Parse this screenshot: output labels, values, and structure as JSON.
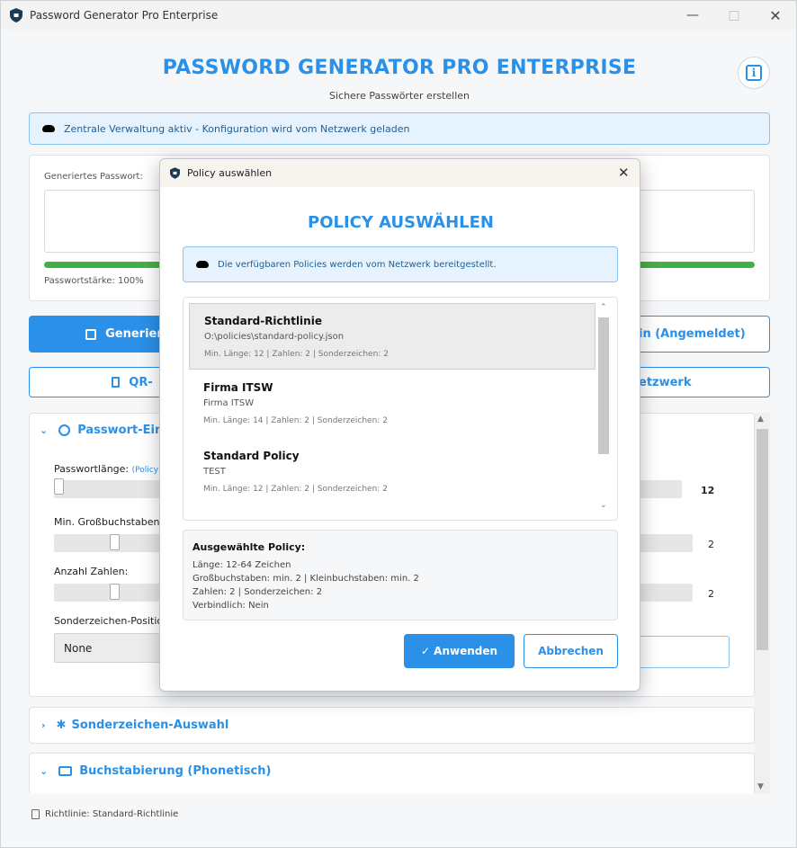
{
  "window": {
    "title": "Password Generator Pro Enterprise"
  },
  "header": {
    "title": "PASSWORD GENERATOR PRO ENTERPRISE",
    "subtitle": "Sichere Passwörter erstellen"
  },
  "banner": {
    "text": "Zentrale Verwaltung aktiv - Konfiguration wird vom Netzwerk geladen"
  },
  "password_panel": {
    "label": "Generiertes Passwort:",
    "strength_label": "Passwortstärke:",
    "strength_value": "100%",
    "strength_fraction": 1.0
  },
  "buttons": {
    "generate": "Generieren",
    "login_suffix": "in (Angemeldet)",
    "qr_prefix": "QR-",
    "network_suffix": "etzwerk"
  },
  "settings": {
    "section_title": "Passwort-Einst",
    "length_label": "Passwortlänge:",
    "length_hint": "(Policy a",
    "length_value": "12",
    "upper_label": "Min. Großbuchstaben:",
    "upper_value": "2",
    "digits_label": "Anzahl Zahlen:",
    "digits_value": "2",
    "position_label": "Sonderzeichen-Positio",
    "position_value": "None"
  },
  "sections": {
    "special": "Sonderzeichen-Auswahl",
    "phonetic": "Buchstabierung (Phonetisch)"
  },
  "footer": {
    "text": "Richtlinie: Standard-Richtlinie"
  },
  "dialog": {
    "window_title": "Policy auswählen",
    "title": "POLICY AUSWÄHLEN",
    "info": "Die verfügbaren Policies werden vom Netzwerk bereitgestellt.",
    "policies": [
      {
        "name": "Standard-Richtlinie",
        "path": "O:\\policies\\standard-policy.json",
        "meta": "Min. Länge: 12  | Zahlen: 2  | Sonderzeichen: 2",
        "selected": true
      },
      {
        "name": "Firma ITSW",
        "path": "Firma ITSW",
        "meta": "Min. Länge: 14  | Zahlen: 2  | Sonderzeichen: 2",
        "selected": false
      },
      {
        "name": "Standard Policy",
        "path": "TEST",
        "meta": "Min. Länge: 12  | Zahlen: 2  | Sonderzeichen: 2",
        "selected": false
      }
    ],
    "selected": {
      "heading": "Ausgewählte Policy:",
      "length": "Länge: 12-64 Zeichen",
      "cases": "Großbuchstaben: min. 2 | Kleinbuchstaben: min. 2",
      "digits": "Zahlen: 2 | Sonderzeichen: 2",
      "binding": "Verbindlich: Nein"
    },
    "apply": "✓ Anwenden",
    "cancel": "Abbrechen"
  },
  "colors": {
    "accent": "#2b90e8",
    "strength": "#43b047",
    "banner_bg": "#e6f2fd"
  }
}
